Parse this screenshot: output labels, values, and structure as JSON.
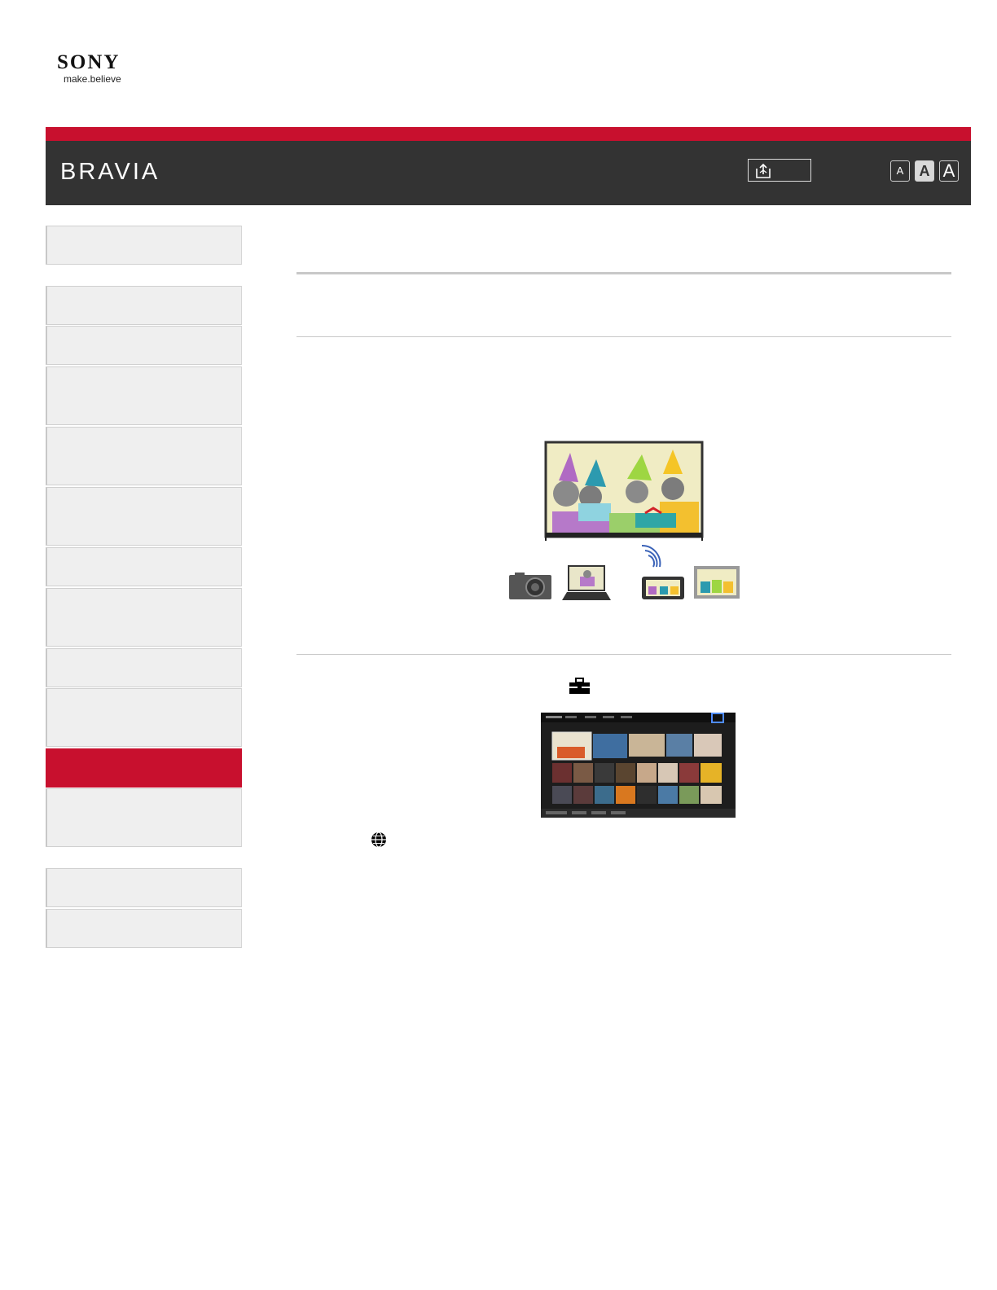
{
  "logo": {
    "brand": "SONY",
    "tagline": "make.believe"
  },
  "header": {
    "product": "BRAVIA"
  },
  "font_size_buttons": [
    "A",
    "A",
    "A"
  ],
  "colors": {
    "accent_red": "#c8102e",
    "header_bg": "#333333",
    "sidebar_bg": "#efefef"
  },
  "icons": [
    "share-icon",
    "toolbox-icon",
    "globe-icon"
  ],
  "sidebar": {
    "active_index": 9
  }
}
